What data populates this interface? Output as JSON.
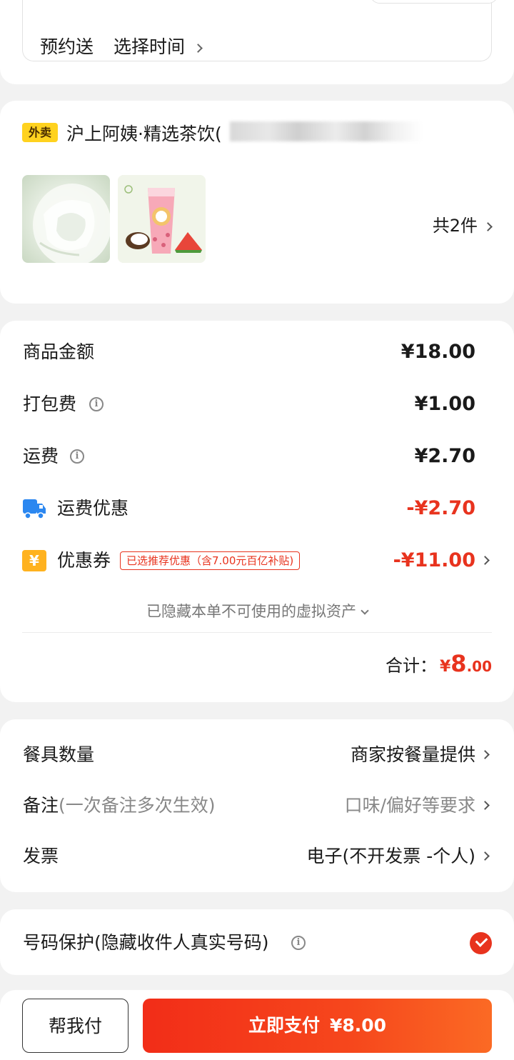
{
  "delivery": {
    "mode": "预约送",
    "time_label": "选择时间"
  },
  "store": {
    "badge": "外卖",
    "name": "沪上阿姨·精选茶饮(",
    "items": [
      {
        "icon": "drink-ice-image"
      },
      {
        "icon": "coconut-watermelon-drink-image"
      }
    ],
    "item_count_label": "共2件"
  },
  "price": {
    "goods_label": "商品金额",
    "goods_amount": "¥18.00",
    "packing_label": "打包费",
    "packing_amount": "¥1.00",
    "shipping_label": "运费",
    "shipping_amount": "¥2.70",
    "ship_discount_label": "运费优惠",
    "ship_discount_amount": "-¥2.70",
    "coupon_label": "优惠券",
    "coupon_tag": "已选推荐优惠（含7.00元百亿补贴)",
    "coupon_amount": "-¥11.00",
    "hidden_assets": "已隐藏本单不可使用的虚拟资产",
    "total_label": "合计：",
    "total_currency": "¥",
    "total_integer": "8",
    "total_decimal": ".00",
    "accent_color": "#e8331e"
  },
  "options": {
    "utensils_label": "餐具数量",
    "utensils_value": "商家按餐量提供",
    "notes_label": "备注",
    "notes_sub": "(一次备注多次生效)",
    "notes_placeholder": "口味/偏好等要求",
    "invoice_label": "发票",
    "invoice_value": "电子(不开发票 -个人)"
  },
  "privacy": {
    "label": "号码保护(隐藏收件人真实号码)",
    "checked": true
  },
  "footer": {
    "help_pay": "帮我付",
    "pay_now": "立即支付",
    "pay_amount": "¥8.00"
  }
}
